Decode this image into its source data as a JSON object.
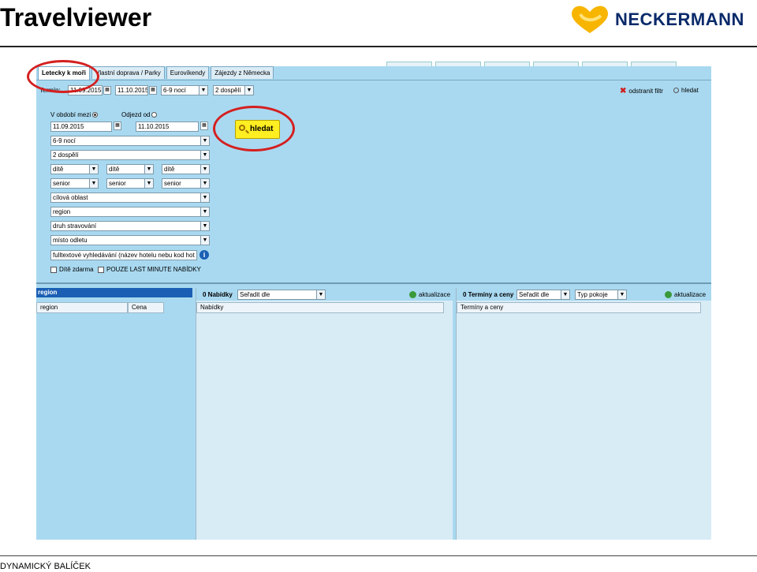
{
  "slide": {
    "title": "Travelviewer",
    "brand": "NECKERMANN",
    "footer": "DYNAMICKÝ BALÍČEK"
  },
  "tabs": [
    {
      "label": "Letecky k moři",
      "active": true
    },
    {
      "label": "Vlastní doprava / Parky",
      "active": false
    },
    {
      "label": "Eurovíkendy",
      "active": false
    },
    {
      "label": "Zájezdy z Německa",
      "active": false
    }
  ],
  "toolbar": {
    "from_label": "Termín:",
    "date_from": "11.09.2015",
    "date_to": "11.10.2015",
    "nights": "6-9 nocí",
    "adults": "2 dospělí",
    "remove_filter": "odstranit filtr",
    "search": "hledat"
  },
  "form": {
    "period_label": "V období mezi",
    "departure_label": "Odjezd od",
    "date_from": "11.09.2015",
    "date_to": "11.10.2015",
    "nights": "6-9 nocí",
    "adults": "2 dospělí",
    "child": [
      "dítě",
      "dítě",
      "dítě"
    ],
    "senior": [
      "senior",
      "senior",
      "senior"
    ],
    "destination": "cílová oblast",
    "region": "region",
    "board": "druh stravování",
    "departure_place": "místo odletu",
    "fulltext": "fulltextové vyhledávání  (název hotelu nebu kod hot",
    "child_free": "Dítě zdarma",
    "last_minute": "POUZE LAST MINUTE NABÍDKY",
    "search_button": "hledat"
  },
  "left_pane": {
    "header": "region",
    "col_region": "region",
    "col_price": "Cena"
  },
  "offers_pane": {
    "count_label": "0 Nabídky",
    "sort_placeholder": "Seřadit dle",
    "refresh": "aktualizace",
    "column": "Nabídky"
  },
  "terms_pane": {
    "count_label": "0 Termíny a ceny",
    "sort_placeholder": "Seřadit dle",
    "room_type": "Typ pokoje",
    "refresh": "aktualizace",
    "column": "Termíny a ceny"
  },
  "colors": {
    "app_bg": "#a9d9f0",
    "highlight_ring": "#d42020",
    "search_button": "#ffee22",
    "header_blue": "#1a5fb4"
  }
}
